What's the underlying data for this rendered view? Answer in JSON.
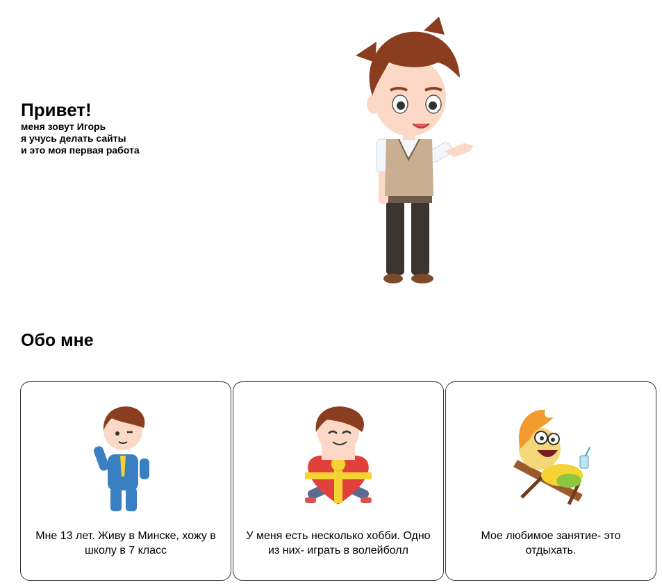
{
  "hero": {
    "title": "Привет!",
    "lines": [
      "меня зовут Игорь",
      "я учусь делать сайты",
      "и это моя первая работа"
    ]
  },
  "about": {
    "title": "Обо мне",
    "cards": [
      {
        "icon": "businessman-boy-icon",
        "text": "Мне 13 лет. Живу в Минске, хожу в школу в 7 класс"
      },
      {
        "icon": "boy-with-heart-gift-icon",
        "text": "У меня есть несколько хобби. Одно из них- играть в волейболл"
      },
      {
        "icon": "relaxing-on-deck-chair-icon",
        "text": "Мое любимое занятие- это отдыхать."
      }
    ]
  },
  "colors": {
    "hair": "#8B3E1F",
    "vest": "#C9AE92",
    "suit": "#3A7FC1",
    "heart": "#E2403B",
    "bow": "#F5D332",
    "sun_hair": "#F39A2C"
  }
}
